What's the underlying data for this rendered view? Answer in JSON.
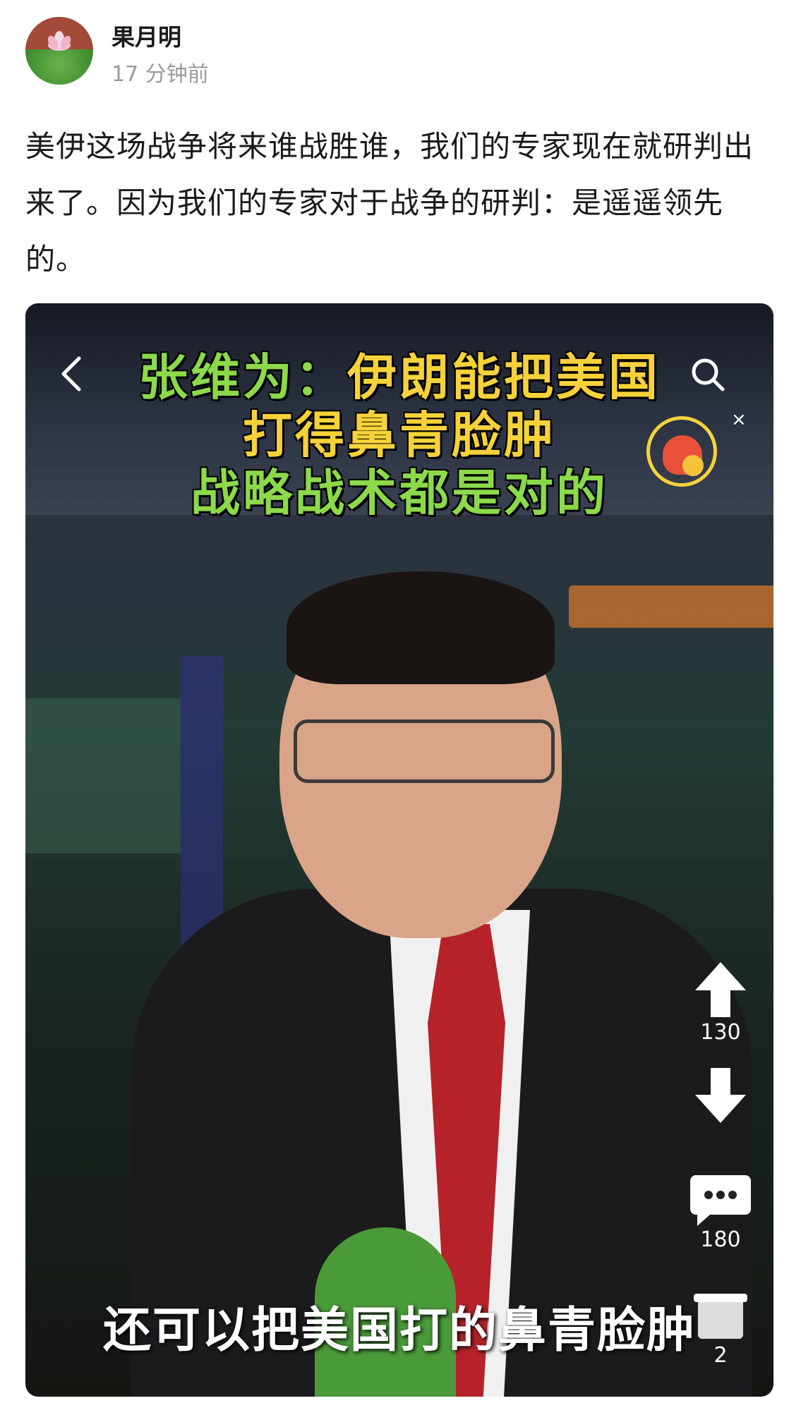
{
  "post": {
    "author": "果月明",
    "time": "17 分钟前",
    "text": "美伊这场战争将来谁战胜谁，我们的专家现在就研判出来了。因为我们的专家对于战争的研判：是遥遥领先的。"
  },
  "video": {
    "title_lines": [
      {
        "parts": [
          {
            "text": "张维为：",
            "color": "green"
          },
          {
            "text": "伊朗能把美国",
            "color": "yellow"
          }
        ]
      },
      {
        "parts": [
          {
            "text": "打得鼻青脸肿",
            "color": "yellow"
          }
        ]
      },
      {
        "parts": [
          {
            "text": "战略战术都是对的",
            "color": "green"
          }
        ]
      }
    ],
    "subtitle": "还可以把美国打的鼻青脸肿",
    "close_label": "×",
    "controls": {
      "upvote_count": "130",
      "comment_count": "180",
      "share_count": "2"
    }
  },
  "colors": {
    "title_green": "#8cd94a",
    "title_yellow": "#f6d23a",
    "tie_red": "#b5222a"
  },
  "icons": [
    "back-icon",
    "search-icon",
    "close-icon",
    "red-packet-icon",
    "arrow-up-icon",
    "arrow-down-icon",
    "comment-icon",
    "share-icon"
  ]
}
